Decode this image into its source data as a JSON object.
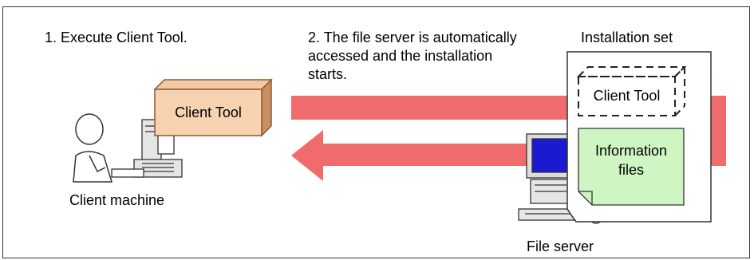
{
  "steps": {
    "step1": "1. Execute Client Tool.",
    "step2_line1": "2. The file server is automatically",
    "step2_line2": "accessed and the installation",
    "step2_line3": "starts."
  },
  "installation_set": {
    "title": "Installation set",
    "client_tool": "Client Tool",
    "info_line1": "Information",
    "info_line2": "files"
  },
  "client": {
    "box_label": "Client Tool",
    "caption": "Client machine"
  },
  "server": {
    "caption": "File server"
  },
  "colors": {
    "arrow": "#f06b6b",
    "client_box": "#f6d2b0",
    "info_files": "#cff5c2",
    "monitor_screen": "#1a1ad0"
  }
}
